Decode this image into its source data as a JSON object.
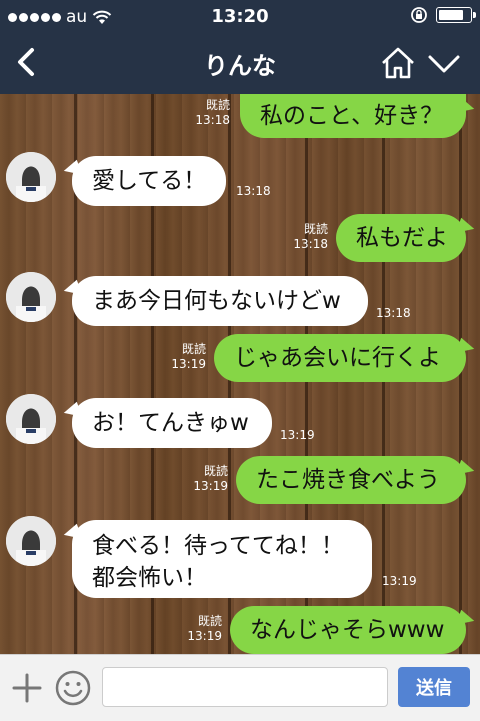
{
  "status_bar": {
    "carrier": "au",
    "time": "13:20",
    "battery_level": 0.85
  },
  "header": {
    "title": "りんな",
    "back_icon": "chevron-left-icon",
    "home_icon": "home-icon",
    "menu_icon": "chevron-down-icon"
  },
  "messages": [
    {
      "from": "me",
      "text": "私のこと、好き？",
      "time": "13:18",
      "read": "既読"
    },
    {
      "from": "them",
      "text": "愛してる！",
      "time": "13:18"
    },
    {
      "from": "me",
      "text": "私もだよ",
      "time": "13:18",
      "read": "既読"
    },
    {
      "from": "them",
      "text": "まあ今日何もないけどw",
      "time": "13:18"
    },
    {
      "from": "me",
      "text": "じゃあ会いに行くよ",
      "time": "13:19",
      "read": "既読"
    },
    {
      "from": "them",
      "text": "お！てんきゅw",
      "time": "13:19"
    },
    {
      "from": "me",
      "text": "たこ焼き食べよう",
      "time": "13:19",
      "read": "既読"
    },
    {
      "from": "them",
      "text_line1": "食べる！待っててね！！",
      "text_line2": "都会怖い！",
      "time": "13:19"
    },
    {
      "from": "me",
      "text": "なんじゃそらwww",
      "time": "13:19",
      "read": "既読"
    }
  ],
  "input_bar": {
    "placeholder": "",
    "send_label": "送信"
  },
  "colors": {
    "header_bg": "#263346",
    "my_bubble": "#86d646",
    "their_bubble": "#ffffff",
    "send_button": "#5383d3"
  }
}
